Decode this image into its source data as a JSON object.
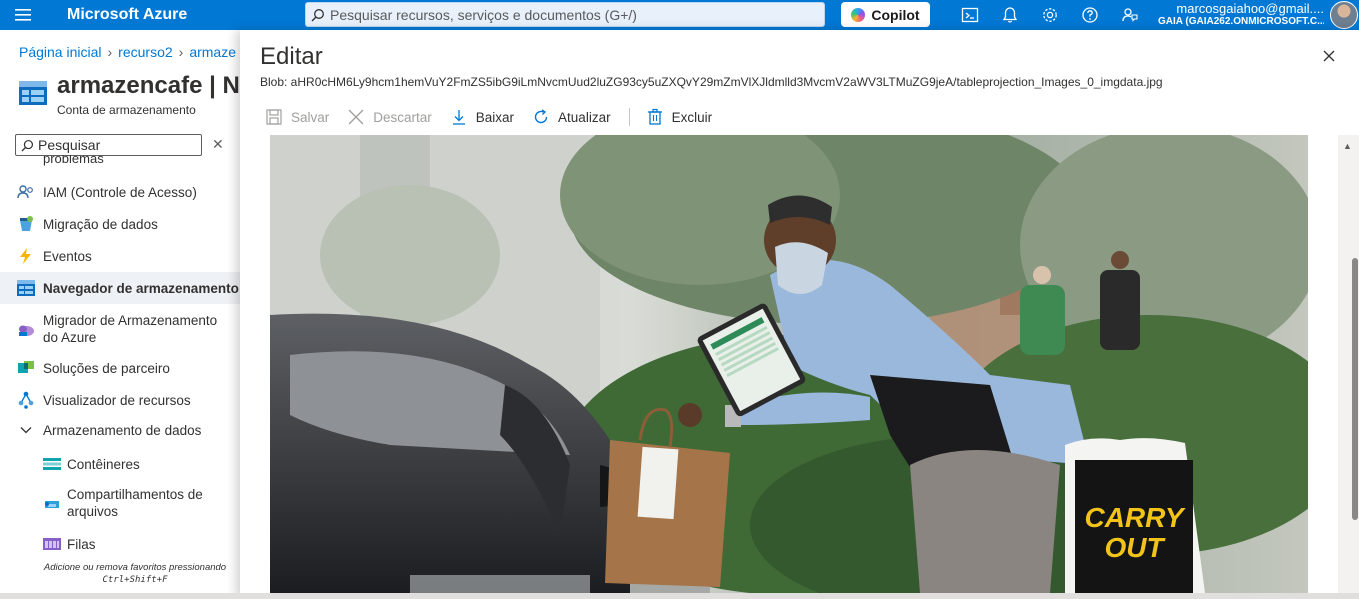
{
  "topbar": {
    "brand": "Microsoft Azure",
    "search_placeholder": "Pesquisar recursos, serviços e documentos (G+/)",
    "copilot_label": "Copilot",
    "icons": [
      "cloud-shell-icon",
      "bell-icon",
      "gear-icon",
      "help-icon",
      "feedback-icon"
    ],
    "account_name": "marcosgaiahoo@gmail....",
    "account_directory": "GAIA (GAIA262.ONMICROSOFT.C..."
  },
  "breadcrumb": [
    "Página inicial",
    "recurso2",
    "armaze"
  ],
  "resource": {
    "title": "armazencafe | Na",
    "subtitle": "Conta de armazenamento"
  },
  "left_search": {
    "placeholder": "Pesquisar"
  },
  "nav": {
    "cut_item": "problemas",
    "items": [
      {
        "label": "IAM (Controle de Acesso)",
        "icon": "iam-icon"
      },
      {
        "label": "Migração de dados",
        "icon": "migration-icon"
      },
      {
        "label": "Eventos",
        "icon": "lightning-icon"
      },
      {
        "label": "Navegador de armazenamento",
        "icon": "storage-browser-icon",
        "active": true
      },
      {
        "label": "Migrador de Armazenamento do Azure",
        "icon": "storage-mover-icon"
      },
      {
        "label": "Soluções de parceiro",
        "icon": "partner-icon"
      },
      {
        "label": "Visualizador de recursos",
        "icon": "resource-visualizer-icon"
      },
      {
        "label": "Armazenamento de dados",
        "icon": "chevron-down-icon"
      },
      {
        "label": "Contêineres",
        "icon": "container-icon"
      },
      {
        "label": "Compartilhamentos de arquivos",
        "icon": "file-share-icon"
      },
      {
        "label": "Filas",
        "icon": "queue-icon"
      }
    ],
    "footer_text": "Adicione ou remova favoritos pressionando",
    "footer_shortcut": "Ctrl+Shift+F"
  },
  "blade": {
    "title": "Editar",
    "blob": "Blob: aHR0cHM6Ly9hcm1hemVuY2FmZS5ibG9iLmNvcmUud2luZG93cy5uZXQvY29mZmVlXJldmlld3MvcmV2aWV3LTMuZG9jeA/tableprojection_Images_0_imgdata.jpg",
    "toolbar": {
      "save": "Salvar",
      "discard": "Descartar",
      "download": "Baixar",
      "refresh": "Atualizar",
      "delete": "Excluir"
    },
    "sign_text_line1": "CARRY",
    "sign_text_line2": "OUT"
  },
  "colors": {
    "azure_blue": "#0078d4",
    "active_nav": "#eef1f5"
  }
}
